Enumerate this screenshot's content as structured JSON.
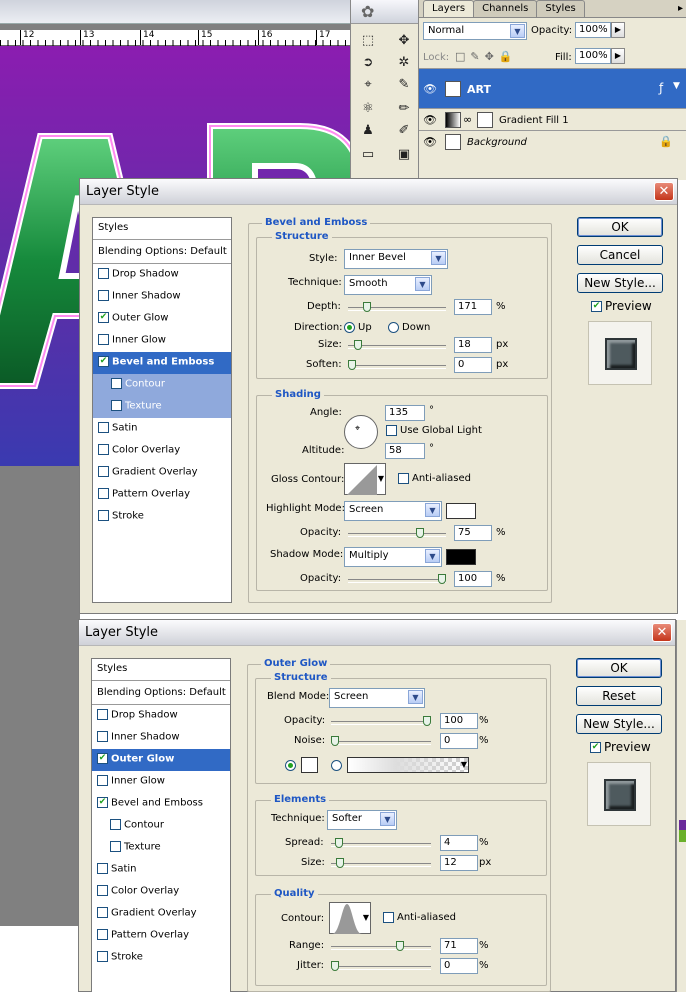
{
  "ruler": {
    "ticks": [
      "12",
      "13",
      "14",
      "15",
      "16",
      "17"
    ]
  },
  "layers_panel": {
    "tabs": [
      "Layers",
      "Channels",
      "Styles"
    ],
    "blend_mode": "Normal",
    "opacity_label": "Opacity:",
    "opacity_value": "100%",
    "lock_label": "Lock:",
    "fill_label": "Fill:",
    "fill_value": "100%",
    "layers": [
      {
        "name": "ART",
        "selected": true
      },
      {
        "name": "Gradient Fill 1",
        "selected": false
      },
      {
        "name": "Background",
        "selected": false
      }
    ]
  },
  "bevel_dialog": {
    "title": "Layer Style",
    "style_list": {
      "header": "Styles",
      "blending": "Blending Options: Default",
      "items": [
        {
          "label": "Drop Shadow",
          "checked": false
        },
        {
          "label": "Inner Shadow",
          "checked": false
        },
        {
          "label": "Outer Glow",
          "checked": true
        },
        {
          "label": "Inner Glow",
          "checked": false
        },
        {
          "label": "Bevel and Emboss",
          "checked": true,
          "selected": true
        },
        {
          "label": "Contour",
          "checked": false,
          "sub": true
        },
        {
          "label": "Texture",
          "checked": false,
          "sub": true
        },
        {
          "label": "Satin",
          "checked": false
        },
        {
          "label": "Color Overlay",
          "checked": false
        },
        {
          "label": "Gradient Overlay",
          "checked": false
        },
        {
          "label": "Pattern Overlay",
          "checked": false
        },
        {
          "label": "Stroke",
          "checked": false
        }
      ]
    },
    "section_title": "Bevel and Emboss",
    "structure_title": "Structure",
    "style_label": "Style:",
    "style_value": "Inner Bevel",
    "technique_label": "Technique:",
    "technique_value": "Smooth",
    "depth_label": "Depth:",
    "depth_value": "171",
    "depth_level": 0.171,
    "direction_label": "Direction:",
    "dir_up": "Up",
    "dir_down": "Down",
    "size_label": "Size:",
    "size_value": "18",
    "size_level": 0.07,
    "soften_label": "Soften:",
    "soften_value": "0",
    "soften_level": 0,
    "shading_title": "Shading",
    "angle_label": "Angle:",
    "angle_value": "135",
    "global_light": "Use Global Light",
    "altitude_label": "Altitude:",
    "altitude_value": "58",
    "gloss_label": "Gloss Contour:",
    "anti_aliased": "Anti-aliased",
    "highlight_label": "Highlight Mode:",
    "highlight_value": "Screen",
    "highlight_color": "#ffffff",
    "hl_opacity_label": "Opacity:",
    "hl_opacity_value": "75",
    "hl_opacity_level": 0.75,
    "shadow_label": "Shadow Mode:",
    "shadow_value": "Multiply",
    "shadow_color": "#000000",
    "sh_opacity_label": "Opacity:",
    "sh_opacity_value": "100",
    "sh_opacity_level": 1.0,
    "pct": "%",
    "px": "px",
    "deg": "°",
    "ok": "OK",
    "cancel": "Cancel",
    "new_style": "New Style...",
    "preview": "Preview"
  },
  "glow_dialog": {
    "title": "Layer Style",
    "style_list": {
      "header": "Styles",
      "blending": "Blending Options: Default",
      "items": [
        {
          "label": "Drop Shadow",
          "checked": false
        },
        {
          "label": "Inner Shadow",
          "checked": false
        },
        {
          "label": "Outer Glow",
          "checked": true,
          "selected": true
        },
        {
          "label": "Inner Glow",
          "checked": false
        },
        {
          "label": "Bevel and Emboss",
          "checked": true
        },
        {
          "label": "Contour",
          "checked": false,
          "sub": true
        },
        {
          "label": "Texture",
          "checked": false,
          "sub": true
        },
        {
          "label": "Satin",
          "checked": false
        },
        {
          "label": "Color Overlay",
          "checked": false
        },
        {
          "label": "Gradient Overlay",
          "checked": false
        },
        {
          "label": "Pattern Overlay",
          "checked": false
        },
        {
          "label": "Stroke",
          "checked": false
        }
      ]
    },
    "section_title": "Outer Glow",
    "structure_title": "Structure",
    "blend_label": "Blend Mode:",
    "blend_value": "Screen",
    "opacity_label": "Opacity:",
    "opacity_value": "100",
    "opacity_level": 1.0,
    "noise_label": "Noise:",
    "noise_value": "0",
    "noise_level": 0,
    "elements_title": "Elements",
    "technique_label": "Technique:",
    "technique_value": "Softer",
    "spread_label": "Spread:",
    "spread_value": "4",
    "spread_level": 0.04,
    "size_label": "Size:",
    "size_value": "12",
    "size_level": 0.05,
    "quality_title": "Quality",
    "contour_label": "Contour:",
    "anti_aliased": "Anti-aliased",
    "range_label": "Range:",
    "range_value": "71",
    "range_level": 0.71,
    "jitter_label": "Jitter:",
    "jitter_value": "0",
    "jitter_level": 0,
    "pct": "%",
    "px": "px",
    "ok": "OK",
    "reset": "Reset",
    "new_style": "New Style...",
    "preview": "Preview"
  }
}
